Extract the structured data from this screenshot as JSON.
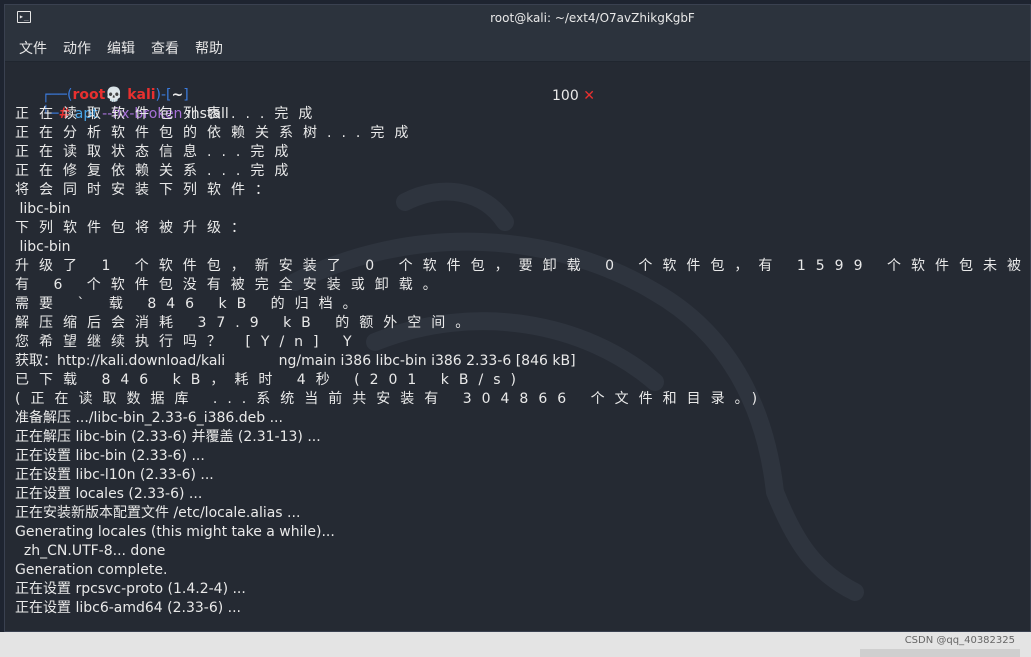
{
  "window": {
    "title": "root@kali: ~/ext4/O7avZhikgKgbF",
    "app_icon": "terminal-icon"
  },
  "menu": [
    "文件",
    "动作",
    "编辑",
    "查看",
    "帮助"
  ],
  "prompt": {
    "frame_open": "┌──(",
    "user": "root",
    "skull": "💀",
    "host": "kali",
    "frame_mid": ")-[",
    "dir": "~",
    "frame_close": "]",
    "frame_bottom": "└─",
    "hash": "#",
    "cmd": "apt",
    "opt": "--fix-broken",
    "arg": " install",
    "status_code": "100",
    "status_mark": "✕"
  },
  "output": [
    {
      "text": "正在读取软件包列表...完成",
      "spaced": true
    },
    {
      "text": "正在分析软件包的依赖关系树...完成",
      "spaced": true
    },
    {
      "text": "正在读取状态信息...完成",
      "spaced": true
    },
    {
      "text": "正在修复依赖关系...完成",
      "spaced": true
    },
    {
      "text": "将会同时安装下列软件：",
      "spaced": true
    },
    {
      "text": " libc-bin",
      "spaced": false
    },
    {
      "text": "下列软件包将被升级：",
      "spaced": true
    },
    {
      "text": " libc-bin",
      "spaced": false
    },
    {
      "text": "升级了 1 个软件包，新安装了 0 个软件包，要卸载 0 个软件包，有 1599 个软件包未被",
      "spaced": true
    },
    {
      "text": "有 6 个软件包没有被完全安装或卸载。",
      "spaced": true
    },
    {
      "text": "需要 ` 载 846 kB 的归档。",
      "spaced": true
    },
    {
      "text": "解压缩后会消耗 37.9 kB 的额外空间。",
      "spaced": true
    },
    {
      "text": "您希望继续执行吗？ [Y/n] Y",
      "spaced": true
    },
    {
      "text": "获取：http://kali.download/kali            ng/main i386 libc-bin i386 2.33-6 [846 kB]",
      "spaced": false
    },
    {
      "text": "已下载 846 kB，耗时 4秒 (201 kB/s)",
      "spaced": true
    },
    {
      "text": "(正在读取数据库 ...系统当前共安装有 304866 个文件和目录。)",
      "spaced": true
    },
    {
      "text": "准备解压 .../libc-bin_2.33-6_i386.deb ...",
      "spaced": false
    },
    {
      "text": "正在解压 libc-bin (2.33-6) 并覆盖 (2.31-13) ...",
      "spaced": false
    },
    {
      "text": "正在设置 libc-bin (2.33-6) ...",
      "spaced": false
    },
    {
      "text": "正在设置 libc-l10n (2.33-6) ...",
      "spaced": false
    },
    {
      "text": "正在设置 locales (2.33-6) ...",
      "spaced": false
    },
    {
      "text": "正在安装新版本配置文件 /etc/locale.alias ...",
      "spaced": false
    },
    {
      "text": "Generating locales (this might take a while)...",
      "spaced": false
    },
    {
      "text": "  zh_CN.UTF-8... done",
      "spaced": false
    },
    {
      "text": "Generation complete.",
      "spaced": false
    },
    {
      "text": "正在设置 rpcsvc-proto (1.4.2-4) ...",
      "spaced": false
    },
    {
      "text": "正在设置 libc6-amd64 (2.33-6) ...",
      "spaced": false
    }
  ],
  "footer": {
    "credit": "CSDN @qq_40382325"
  }
}
